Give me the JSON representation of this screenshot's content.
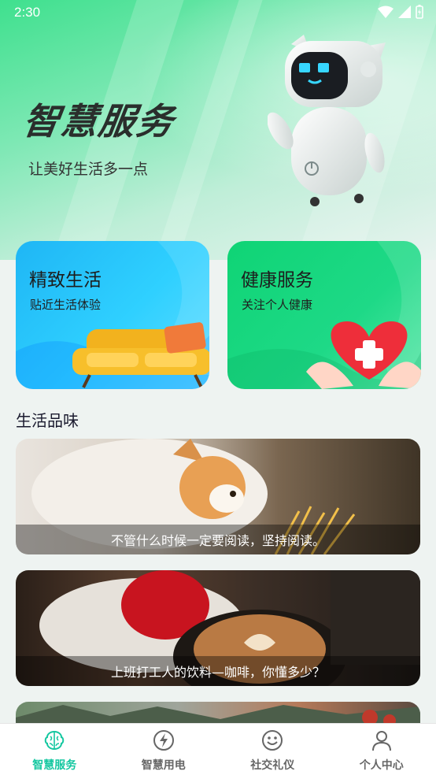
{
  "status_bar": {
    "time": "2:30"
  },
  "hero": {
    "title": "智慧服务",
    "subtitle": "让美好生活多一点"
  },
  "cards": [
    {
      "title": "精致生活",
      "subtitle": "贴近生活体验"
    },
    {
      "title": "健康服务",
      "subtitle": "关注个人健康"
    }
  ],
  "section": {
    "title": "生活品味"
  },
  "articles": [
    {
      "caption": "不管什么时候一定要阅读，坚持阅读。"
    },
    {
      "caption": "上班打工人的饮料—咖啡，你懂多少？"
    }
  ],
  "bottom_nav": {
    "active_color": "#14c7a0",
    "items": [
      {
        "label": "智慧服务",
        "icon": "brain-icon",
        "active": true
      },
      {
        "label": "智慧用电",
        "icon": "lightning-icon",
        "active": false
      },
      {
        "label": "社交礼仪",
        "icon": "smile-icon",
        "active": false
      },
      {
        "label": "个人中心",
        "icon": "person-icon",
        "active": false
      }
    ]
  }
}
